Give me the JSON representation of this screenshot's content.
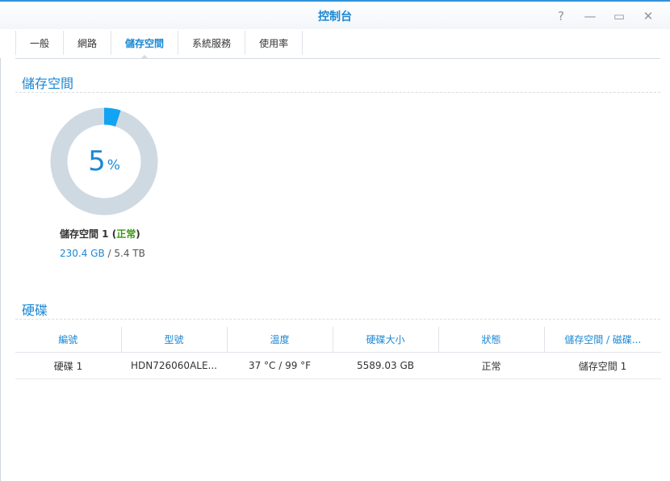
{
  "window": {
    "title": "控制台"
  },
  "controls": {
    "help": "?",
    "minimize": "—",
    "maximize": "▭",
    "close": "✕"
  },
  "tabs": [
    {
      "label": "一般"
    },
    {
      "label": "網路"
    },
    {
      "label": "儲存空間",
      "active": true
    },
    {
      "label": "系統服務"
    },
    {
      "label": "使用率"
    }
  ],
  "storage": {
    "section_title": "儲存空間",
    "percent": "5",
    "percent_sign": "%",
    "usage_fraction": 0.05,
    "volume_name": "儲存空間 1",
    "volume_status": "正常",
    "used": "230.4 GB",
    "separator": " / ",
    "total": "5.4 TB"
  },
  "disks": {
    "section_title": "硬碟",
    "columns": [
      "編號",
      "型號",
      "溫度",
      "硬碟大小",
      "狀態",
      "儲存空間 / 磁碟..."
    ],
    "rows": [
      [
        "硬碟 1",
        "HDN726060ALE...",
        "37 °C / 99 °F",
        "5589.03 GB",
        "正常",
        "儲存空間 1"
      ]
    ]
  },
  "colors": {
    "accent": "#1b88d3",
    "ring_used": "#12a3f2",
    "ring_free": "#cfd9e2",
    "status_ok": "#3a9a16"
  }
}
